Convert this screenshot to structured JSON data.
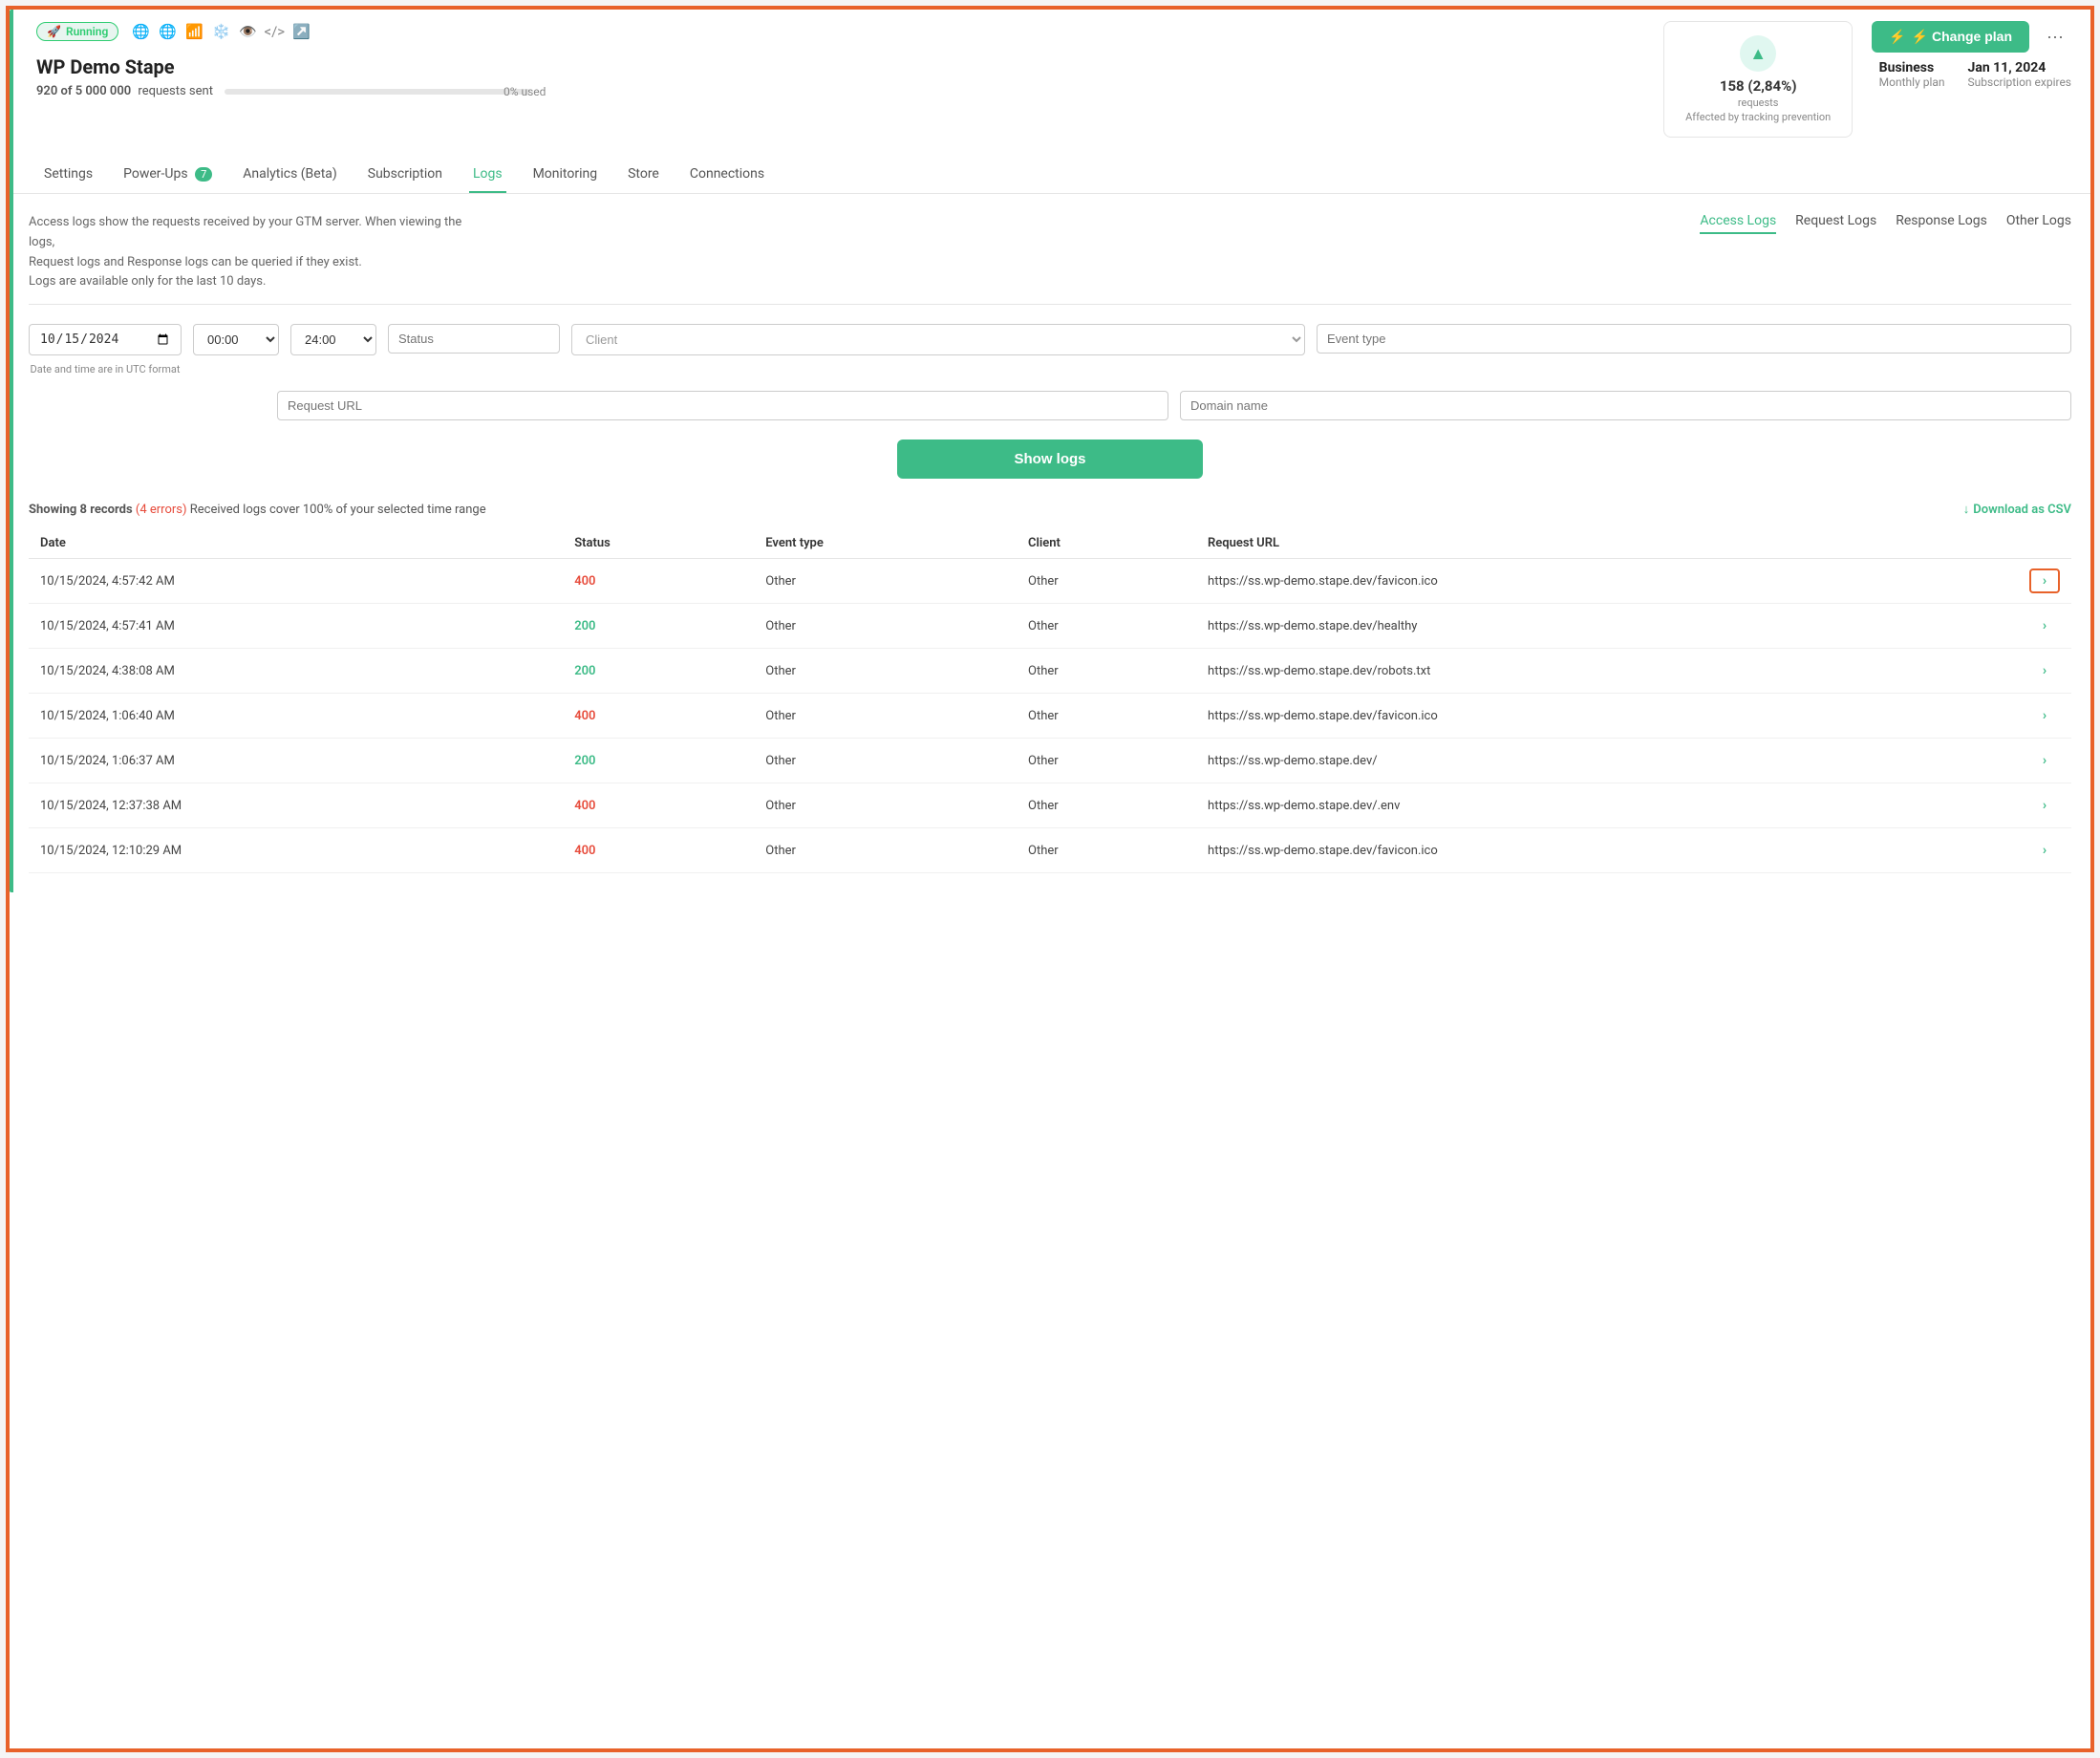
{
  "site": {
    "status": "Running",
    "title": "WP Demo Stape",
    "requests_sent": "920 of 5 000 000",
    "requests_label": "requests sent",
    "progress_percent": 0,
    "progress_text": "0% used",
    "tracking": {
      "count": "158 (2,84%)",
      "requests_label": "requests",
      "description": "Affected by tracking prevention"
    },
    "plan": {
      "name": "Business",
      "type": "Monthly plan",
      "expiry_label": "Jan 11, 2024",
      "expiry_sublabel": "Subscription expires"
    },
    "change_plan_btn": "⚡ Change plan"
  },
  "nav": {
    "tabs": [
      {
        "label": "Settings",
        "active": false
      },
      {
        "label": "Power-Ups",
        "badge": "7",
        "active": false
      },
      {
        "label": "Analytics (Beta)",
        "active": false
      },
      {
        "label": "Subscription",
        "active": false
      },
      {
        "label": "Logs",
        "active": true
      },
      {
        "label": "Monitoring",
        "active": false
      },
      {
        "label": "Store",
        "active": false
      },
      {
        "label": "Connections",
        "active": false
      }
    ]
  },
  "logs_page": {
    "description_line1": "Access logs show the requests received by your GTM server. When viewing the logs,",
    "description_line2": "Request logs and Response logs can be queried if they exist.",
    "description_line3": "Logs are available only for the last 10 days.",
    "log_type_tabs": [
      {
        "label": "Access Logs",
        "active": true
      },
      {
        "label": "Request Logs",
        "active": false
      },
      {
        "label": "Response Logs",
        "active": false
      },
      {
        "label": "Other Logs",
        "active": false
      }
    ],
    "filters": {
      "date": "15.10.2024",
      "time_from": "00:00",
      "time_to": "24:00",
      "status_placeholder": "Status",
      "client_placeholder": "Client",
      "event_type_placeholder": "Event type",
      "request_url_placeholder": "Request URL",
      "domain_name_placeholder": "Domain name",
      "utc_note": "Date and time are in UTC format"
    },
    "show_logs_btn": "Show logs",
    "records_info": {
      "showing": "Showing 8 records",
      "errors": "(4 errors)",
      "coverage": "Received logs cover 100% of your selected time range"
    },
    "download_csv": "Download as CSV",
    "table": {
      "columns": [
        "Date",
        "Status",
        "Event type",
        "Client",
        "Request URL"
      ],
      "rows": [
        {
          "date": "10/15/2024, 4:57:42 AM",
          "status": "400",
          "status_type": "error",
          "event_type": "Other",
          "client": "Other",
          "url": "https://ss.wp-demo.stape.dev/favicon.ico",
          "highlighted": true
        },
        {
          "date": "10/15/2024, 4:57:41 AM",
          "status": "200",
          "status_type": "success",
          "event_type": "Other",
          "client": "Other",
          "url": "https://ss.wp-demo.stape.dev/healthy",
          "highlighted": false
        },
        {
          "date": "10/15/2024, 4:38:08 AM",
          "status": "200",
          "status_type": "success",
          "event_type": "Other",
          "client": "Other",
          "url": "https://ss.wp-demo.stape.dev/robots.txt",
          "highlighted": false
        },
        {
          "date": "10/15/2024, 1:06:40 AM",
          "status": "400",
          "status_type": "error",
          "event_type": "Other",
          "client": "Other",
          "url": "https://ss.wp-demo.stape.dev/favicon.ico",
          "highlighted": false
        },
        {
          "date": "10/15/2024, 1:06:37 AM",
          "status": "200",
          "status_type": "success",
          "event_type": "Other",
          "client": "Other",
          "url": "https://ss.wp-demo.stape.dev/",
          "highlighted": false
        },
        {
          "date": "10/15/2024, 12:37:38 AM",
          "status": "400",
          "status_type": "error",
          "event_type": "Other",
          "client": "Other",
          "url": "https://ss.wp-demo.stape.dev/.env",
          "highlighted": false
        },
        {
          "date": "10/15/2024, 12:10:29 AM",
          "status": "400",
          "status_type": "error",
          "event_type": "Other",
          "client": "Other",
          "url": "https://ss.wp-demo.stape.dev/favicon.ico",
          "highlighted": false
        }
      ]
    }
  },
  "icons": {
    "rocket": "🚀",
    "globe": "🌐",
    "chart": "📊",
    "person": "👤",
    "code": "</>",
    "arrow": "→",
    "lightning": "⚡",
    "more": "···",
    "arrow_up": "▲",
    "chevron_right": ">",
    "download": "↓"
  }
}
